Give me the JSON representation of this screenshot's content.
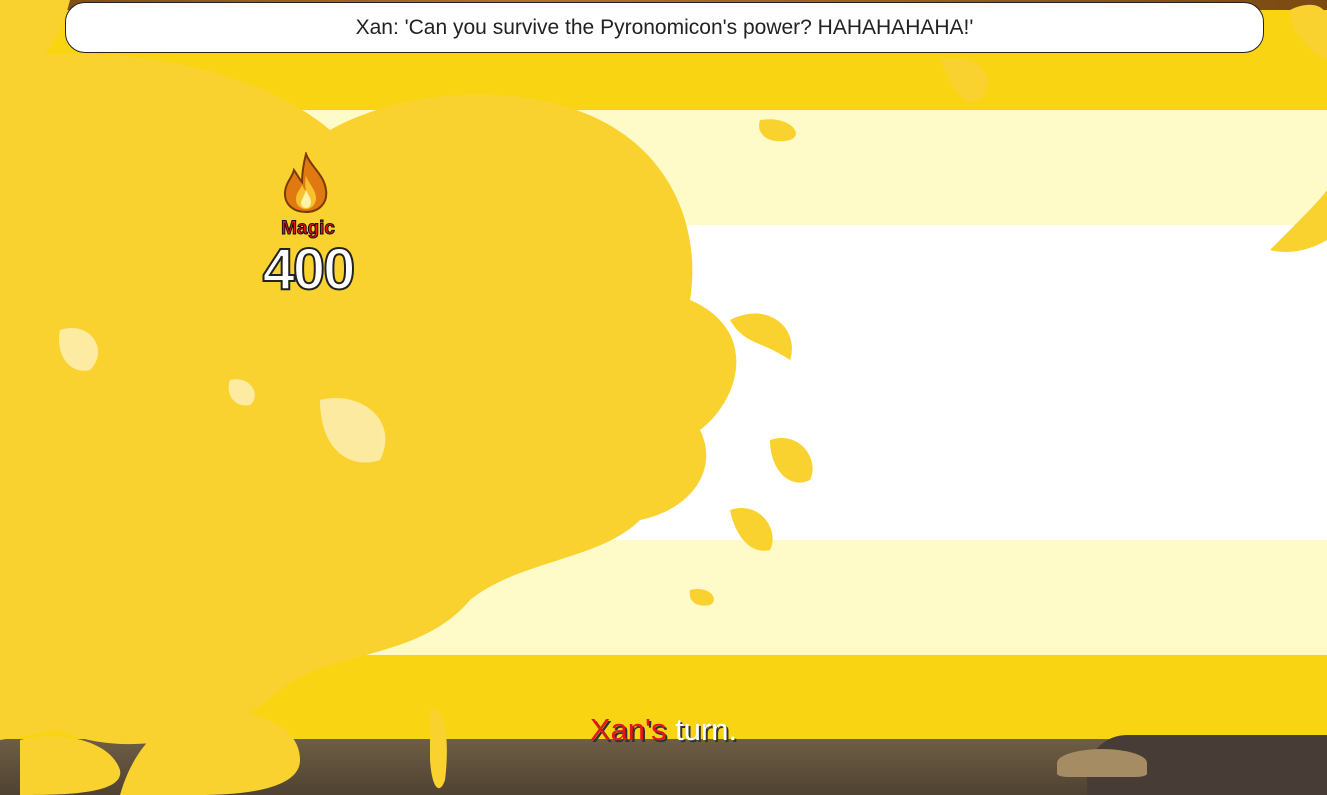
{
  "dialog": {
    "text": "Xan: 'Can you survive the Pyronomicon's power? HAHAHAHAHA!'"
  },
  "damage_popup": {
    "type_label": "Magic",
    "value": "400",
    "icon": "flame-icon"
  },
  "turn_indicator": {
    "name": "Xan's",
    "suffix": "turn."
  },
  "colors": {
    "fire_yellow": "#f8d413",
    "flame_splash": "#fad22f",
    "pale_band": "#fffbc9",
    "label_red": "#e8131b"
  }
}
